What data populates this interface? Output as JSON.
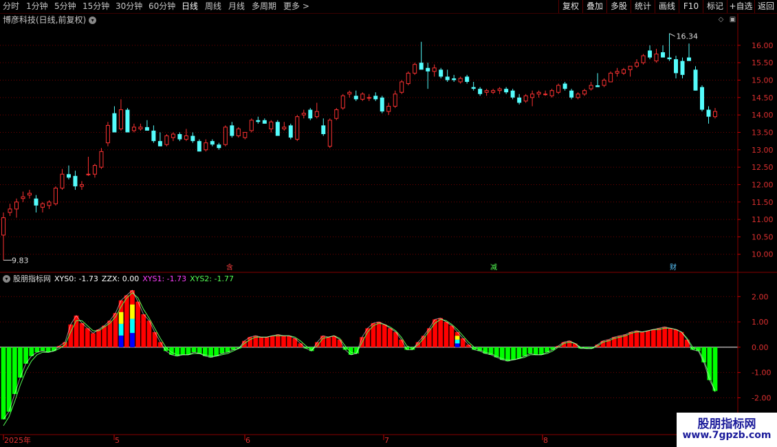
{
  "toolbar": {
    "periods": [
      "分时",
      "1分钟",
      "5分钟",
      "15分钟",
      "30分钟",
      "60分钟",
      "日线",
      "周线",
      "月线",
      "多周期",
      "更多 >"
    ],
    "active_period": "日线",
    "right_buttons": [
      "复权",
      "叠加",
      "多股",
      "统计",
      "画线",
      "F10",
      "标记",
      "+自选",
      "返回"
    ]
  },
  "main_title": "博彦科技(日线,前复权)",
  "sub_header": {
    "name": "股朋指标网",
    "xys0": "XYS0: -1.73",
    "zzx": "ZZX: 0.00",
    "xys1": "XYS1: -1.73",
    "xys2": "XYS2: -1.77"
  },
  "markers": {
    "high": "16.34",
    "low": "9.83"
  },
  "event_labels": [
    "含",
    "减",
    "财"
  ],
  "date_labels": [
    "2025年",
    "5",
    "6",
    "7",
    "8"
  ],
  "watermark": {
    "line1": "股朋指标网",
    "line2": "www.7gpzb.com"
  },
  "colors": {
    "up": "#ff3232",
    "down": "#54fcfc",
    "grid": "#7a0000",
    "bull_bar": "#ff0000",
    "bear_bar": "#00ff00",
    "line1": "#ff40ff",
    "line2": "#54ff54",
    "yellow": "#ffff00",
    "cyan": "#00ffff",
    "blue": "#0000ff"
  },
  "chart_data": [
    {
      "type": "candlestick",
      "title": "博彦科技(日线,前复权)",
      "y_ticks": [
        "16.00",
        "15.50",
        "15.00",
        "14.50",
        "14.00",
        "13.50",
        "13.00",
        "12.50",
        "12.00",
        "11.50",
        "11.00",
        "10.50",
        "10.00"
      ],
      "ylim": [
        9.6,
        16.55
      ],
      "ohlc": [
        [
          10.55,
          11.2,
          9.83,
          11.05
        ],
        [
          11.2,
          11.45,
          11.1,
          11.3
        ],
        [
          11.3,
          11.6,
          11.05,
          11.5
        ],
        [
          11.6,
          11.8,
          11.5,
          11.65
        ],
        [
          11.7,
          11.85,
          11.6,
          11.75
        ],
        [
          11.6,
          11.7,
          11.2,
          11.4
        ],
        [
          11.35,
          11.5,
          11.2,
          11.45
        ],
        [
          11.4,
          11.55,
          11.3,
          11.5
        ],
        [
          11.45,
          11.95,
          11.4,
          11.9
        ],
        [
          11.9,
          12.45,
          11.85,
          12.3
        ],
        [
          12.3,
          12.55,
          12.15,
          12.2
        ],
        [
          12.25,
          12.4,
          11.85,
          11.95
        ],
        [
          11.95,
          12.1,
          11.85,
          12.0
        ],
        [
          12.3,
          12.8,
          12.25,
          12.3
        ],
        [
          12.3,
          12.6,
          12.2,
          12.55
        ],
        [
          12.5,
          13.05,
          12.45,
          12.95
        ],
        [
          13.2,
          13.8,
          13.1,
          13.7
        ],
        [
          14.05,
          14.25,
          13.5,
          13.5
        ],
        [
          13.6,
          14.45,
          13.55,
          14.15
        ],
        [
          14.15,
          14.2,
          13.5,
          13.5
        ],
        [
          13.55,
          13.75,
          13.5,
          13.65
        ],
        [
          13.6,
          13.75,
          13.55,
          13.65
        ],
        [
          13.65,
          13.85,
          13.55,
          13.55
        ],
        [
          13.55,
          13.7,
          13.2,
          13.25
        ],
        [
          13.25,
          13.5,
          13.1,
          13.1
        ],
        [
          13.15,
          13.45,
          13.1,
          13.4
        ],
        [
          13.35,
          13.5,
          13.25,
          13.45
        ],
        [
          13.45,
          13.5,
          13.25,
          13.3
        ],
        [
          13.3,
          13.6,
          13.25,
          13.4
        ],
        [
          13.4,
          13.5,
          13.2,
          13.25
        ],
        [
          13.25,
          13.3,
          12.95,
          12.95
        ],
        [
          13.0,
          13.3,
          12.95,
          13.2
        ],
        [
          13.25,
          13.3,
          13.1,
          13.15
        ],
        [
          13.15,
          13.2,
          13.0,
          13.05
        ],
        [
          13.15,
          13.7,
          13.1,
          13.65
        ],
        [
          13.7,
          13.8,
          13.35,
          13.4
        ],
        [
          13.4,
          13.65,
          13.35,
          13.6
        ],
        [
          13.35,
          13.5,
          13.3,
          13.5
        ],
        [
          13.55,
          13.9,
          13.5,
          13.85
        ],
        [
          13.85,
          13.95,
          13.75,
          13.8
        ],
        [
          13.85,
          13.9,
          13.75,
          13.75
        ],
        [
          13.6,
          13.85,
          13.5,
          13.8
        ],
        [
          13.8,
          13.85,
          13.4,
          13.4
        ],
        [
          13.6,
          13.8,
          13.55,
          13.65
        ],
        [
          13.7,
          13.75,
          13.3,
          13.35
        ],
        [
          13.3,
          14.0,
          13.25,
          13.95
        ],
        [
          14.0,
          14.15,
          13.9,
          14.05
        ],
        [
          14.15,
          14.2,
          13.85,
          13.9
        ],
        [
          13.95,
          14.35,
          13.9,
          14.1
        ],
        [
          13.7,
          13.9,
          13.4,
          13.45
        ],
        [
          13.1,
          13.9,
          13.05,
          13.85
        ],
        [
          13.9,
          14.2,
          13.85,
          14.15
        ],
        [
          14.2,
          14.6,
          14.15,
          14.55
        ],
        [
          14.6,
          14.7,
          14.5,
          14.65
        ],
        [
          14.55,
          14.7,
          14.4,
          14.45
        ],
        [
          14.45,
          14.65,
          14.4,
          14.6
        ],
        [
          14.5,
          14.6,
          14.4,
          14.5
        ],
        [
          14.55,
          14.65,
          14.4,
          14.45
        ],
        [
          14.5,
          14.55,
          14.05,
          14.1
        ],
        [
          14.1,
          14.35,
          14.0,
          14.25
        ],
        [
          14.25,
          14.7,
          14.2,
          14.6
        ],
        [
          14.65,
          15.0,
          14.6,
          14.95
        ],
        [
          14.9,
          15.25,
          14.85,
          15.2
        ],
        [
          15.2,
          15.5,
          15.15,
          15.45
        ],
        [
          15.5,
          16.1,
          15.4,
          15.3
        ],
        [
          15.35,
          15.5,
          14.75,
          15.25
        ],
        [
          15.25,
          15.45,
          15.1,
          15.35
        ],
        [
          15.3,
          15.35,
          15.05,
          15.1
        ],
        [
          15.1,
          15.3,
          14.95,
          15.0
        ],
        [
          15.05,
          15.15,
          14.95,
          15.0
        ],
        [
          14.95,
          15.1,
          14.9,
          15.05
        ],
        [
          15.1,
          15.15,
          14.9,
          14.95
        ],
        [
          14.8,
          14.95,
          14.7,
          14.75
        ],
        [
          14.75,
          14.8,
          14.55,
          14.6
        ],
        [
          14.65,
          14.75,
          14.55,
          14.7
        ],
        [
          14.65,
          14.75,
          14.6,
          14.7
        ],
        [
          14.7,
          14.8,
          14.6,
          14.75
        ],
        [
          14.75,
          14.8,
          14.6,
          14.65
        ],
        [
          14.7,
          14.75,
          14.45,
          14.5
        ],
        [
          14.5,
          14.6,
          14.3,
          14.35
        ],
        [
          14.4,
          14.6,
          14.35,
          14.55
        ],
        [
          14.5,
          14.7,
          14.25,
          14.6
        ],
        [
          14.6,
          14.7,
          14.5,
          14.65
        ],
        [
          14.6,
          14.7,
          14.55,
          14.6
        ],
        [
          14.55,
          14.75,
          14.5,
          14.7
        ],
        [
          14.65,
          14.9,
          14.6,
          14.85
        ],
        [
          14.9,
          14.95,
          14.7,
          14.75
        ],
        [
          14.7,
          14.75,
          14.45,
          14.5
        ],
        [
          14.5,
          14.65,
          14.45,
          14.6
        ],
        [
          14.6,
          14.75,
          14.55,
          14.7
        ],
        [
          14.75,
          14.95,
          14.7,
          14.85
        ],
        [
          14.85,
          15.2,
          14.8,
          14.8
        ],
        [
          14.85,
          15.05,
          14.8,
          15.0
        ],
        [
          14.95,
          15.25,
          14.95,
          15.2
        ],
        [
          15.2,
          15.35,
          15.1,
          15.25
        ],
        [
          15.2,
          15.35,
          15.15,
          15.3
        ],
        [
          15.3,
          15.4,
          15.1,
          15.4
        ],
        [
          15.4,
          15.6,
          15.35,
          15.5
        ],
        [
          15.5,
          15.75,
          15.45,
          15.7
        ],
        [
          15.85,
          16.0,
          15.6,
          15.65
        ],
        [
          15.55,
          15.9,
          15.5,
          15.75
        ],
        [
          15.8,
          16.0,
          15.65,
          15.65
        ],
        [
          15.65,
          16.34,
          15.55,
          15.6
        ],
        [
          15.6,
          15.7,
          15.05,
          15.2
        ],
        [
          15.55,
          15.65,
          15.05,
          15.15
        ],
        [
          15.65,
          16.05,
          15.55,
          15.55
        ],
        [
          15.3,
          15.4,
          14.7,
          14.7
        ],
        [
          14.8,
          14.85,
          14.1,
          14.15
        ],
        [
          14.15,
          14.25,
          13.75,
          13.95
        ],
        [
          13.95,
          14.2,
          13.9,
          14.1
        ]
      ]
    },
    {
      "type": "bar",
      "title": "股朋指标网",
      "y_ticks": [
        "2.00",
        "1.00",
        "0.00",
        "-1.00",
        "-2.00"
      ],
      "ylim": [
        -3.4,
        2.85
      ],
      "series": [
        {
          "name": "XYS0",
          "values": [
            -2.85,
            -2.55,
            -1.85,
            -1.2,
            -0.65,
            -0.35,
            -0.2,
            -0.15,
            -0.2,
            -0.15,
            0.05,
            0.2,
            0.9,
            1.25,
            0.95,
            0.75,
            0.55,
            0.7,
            0.85,
            1.05,
            1.35,
            1.85,
            2.05,
            2.25,
            1.8,
            1.3,
            1.05,
            0.6,
            0.2,
            -0.15,
            -0.3,
            -0.35,
            -0.3,
            -0.3,
            -0.2,
            -0.25,
            -0.35,
            -0.4,
            -0.35,
            -0.25,
            -0.2,
            -0.1,
            -0.05,
            0.25,
            0.4,
            0.45,
            0.4,
            0.4,
            0.45,
            0.5,
            0.45,
            0.45,
            0.35,
            0.15,
            -0.05,
            -0.15,
            0.2,
            0.45,
            0.4,
            0.45,
            0.3,
            -0.1,
            -0.3,
            -0.25,
            0.4,
            0.75,
            0.95,
            1.0,
            0.9,
            0.75,
            0.6,
            0.3,
            -0.1,
            -0.1,
            0.2,
            0.45,
            0.75,
            1.1,
            1.15,
            1.0,
            0.85,
            0.6,
            0.35,
            0.1,
            -0.1,
            -0.15,
            -0.25,
            -0.3,
            -0.4,
            -0.5,
            -0.55,
            -0.5,
            -0.45,
            -0.35,
            -0.25,
            -0.3,
            -0.3,
            -0.2,
            -0.1,
            0.05,
            0.2,
            0.25,
            0.15,
            -0.05,
            -0.05,
            -0.05,
            0.1,
            0.25,
            0.3,
            0.4,
            0.45,
            0.5,
            0.6,
            0.65,
            0.6,
            0.65,
            0.7,
            0.75,
            0.8,
            0.75,
            0.7,
            0.6,
            0.3,
            -0.1,
            -0.15,
            -0.6,
            -1.3,
            -1.73
          ]
        },
        {
          "name": "XYS1",
          "values": [
            -2.85,
            -2.55,
            -1.85,
            -1.2,
            -0.65,
            -0.35,
            -0.2,
            -0.15,
            -0.2,
            -0.15,
            0.05,
            0.2,
            0.9,
            1.25,
            0.95,
            0.75,
            0.55,
            0.7,
            0.85,
            1.05,
            1.35,
            1.85,
            2.05,
            2.25,
            1.8,
            1.3,
            1.05,
            0.6,
            0.2,
            -0.15,
            -0.3,
            -0.35,
            -0.3,
            -0.3,
            -0.2,
            -0.25,
            -0.35,
            -0.4,
            -0.35,
            -0.25,
            -0.2,
            -0.1,
            -0.05,
            0.25,
            0.4,
            0.45,
            0.4,
            0.4,
            0.45,
            0.5,
            0.45,
            0.45,
            0.35,
            0.15,
            -0.05,
            -0.15,
            0.2,
            0.45,
            0.4,
            0.45,
            0.3,
            -0.1,
            -0.3,
            -0.25,
            0.4,
            0.75,
            0.95,
            1.0,
            0.9,
            0.75,
            0.6,
            0.3,
            -0.1,
            -0.1,
            0.2,
            0.45,
            0.75,
            1.1,
            1.15,
            1.0,
            0.85,
            0.6,
            0.35,
            0.1,
            -0.1,
            -0.15,
            -0.25,
            -0.3,
            -0.4,
            -0.5,
            -0.55,
            -0.5,
            -0.45,
            -0.35,
            -0.25,
            -0.3,
            -0.3,
            -0.2,
            -0.1,
            0.05,
            0.2,
            0.25,
            0.15,
            -0.05,
            -0.05,
            -0.05,
            0.1,
            0.25,
            0.3,
            0.4,
            0.45,
            0.5,
            0.6,
            0.65,
            0.6,
            0.65,
            0.7,
            0.75,
            0.8,
            0.75,
            0.7,
            0.6,
            0.3,
            -0.1,
            -0.15,
            -0.6,
            -1.3,
            -1.73
          ]
        },
        {
          "name": "XYS2",
          "values": [
            -3.1,
            -2.75,
            -2.15,
            -1.5,
            -0.95,
            -0.55,
            -0.3,
            -0.2,
            -0.2,
            -0.15,
            -0.05,
            0.1,
            0.6,
            1.05,
            1.05,
            0.85,
            0.65,
            0.65,
            0.8,
            0.95,
            1.2,
            1.6,
            1.95,
            2.15,
            1.95,
            1.5,
            1.15,
            0.75,
            0.35,
            0.0,
            -0.2,
            -0.3,
            -0.3,
            -0.3,
            -0.25,
            -0.25,
            -0.3,
            -0.35,
            -0.35,
            -0.3,
            -0.25,
            -0.15,
            -0.05,
            0.15,
            0.3,
            0.4,
            0.4,
            0.4,
            0.45,
            0.45,
            0.45,
            0.45,
            0.4,
            0.25,
            0.05,
            -0.1,
            0.05,
            0.35,
            0.4,
            0.45,
            0.35,
            0.05,
            -0.2,
            -0.25,
            0.2,
            0.6,
            0.85,
            0.95,
            0.9,
            0.8,
            0.65,
            0.4,
            0.05,
            -0.05,
            0.1,
            0.35,
            0.65,
            0.95,
            1.1,
            1.05,
            0.9,
            0.7,
            0.45,
            0.2,
            0.0,
            -0.1,
            -0.2,
            -0.25,
            -0.35,
            -0.45,
            -0.5,
            -0.5,
            -0.45,
            -0.4,
            -0.3,
            -0.3,
            -0.3,
            -0.25,
            -0.15,
            0.0,
            0.15,
            0.2,
            0.15,
            0.0,
            -0.05,
            -0.05,
            0.05,
            0.2,
            0.25,
            0.35,
            0.4,
            0.45,
            0.55,
            0.6,
            0.6,
            0.65,
            0.7,
            0.7,
            0.75,
            0.75,
            0.7,
            0.6,
            0.35,
            0.0,
            -0.1,
            -0.5,
            -1.15,
            -1.77
          ]
        },
        {
          "name": "ZZX",
          "values": [
            0
          ]
        }
      ]
    }
  ]
}
